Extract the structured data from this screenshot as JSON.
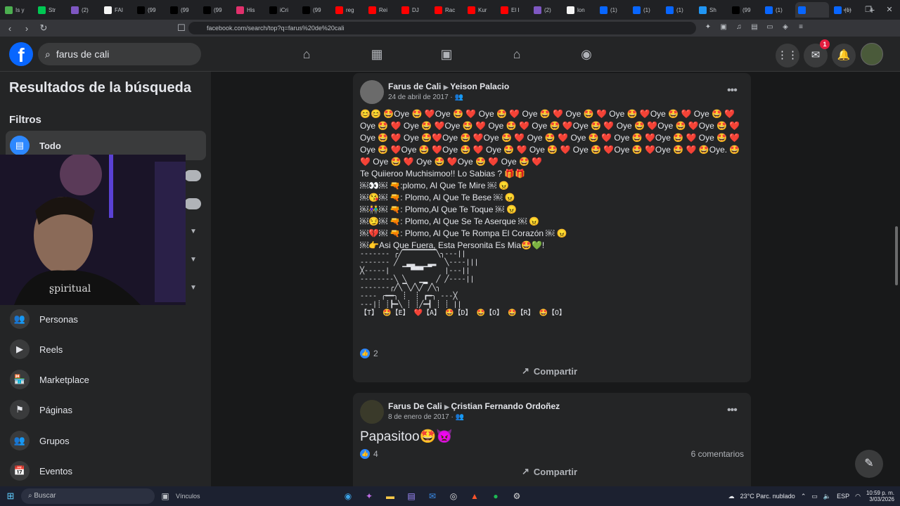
{
  "browser": {
    "tabs": [
      {
        "label": "Is y",
        "color": "#4caf50"
      },
      {
        "label": "Str",
        "color": "#00c853"
      },
      {
        "label": "(2)",
        "color": "#7e57c2"
      },
      {
        "label": "FAI",
        "color": "#f5f5f5"
      },
      {
        "label": "(99",
        "color": "#000000"
      },
      {
        "label": "(99",
        "color": "#000000"
      },
      {
        "label": "(99",
        "color": "#000000"
      },
      {
        "label": "His",
        "color": "#e1306c"
      },
      {
        "label": "iCri",
        "color": "#000000"
      },
      {
        "label": "(99",
        "color": "#000000"
      },
      {
        "label": "reg",
        "color": "#ff0000"
      },
      {
        "label": "Rei",
        "color": "#ff0000"
      },
      {
        "label": "DJ",
        "color": "#ff0000"
      },
      {
        "label": "Rac",
        "color": "#ff0000"
      },
      {
        "label": "Kur",
        "color": "#ff0000"
      },
      {
        "label": "El I",
        "color": "#ff0000"
      },
      {
        "label": "(2)",
        "color": "#7e57c2"
      },
      {
        "label": "lon",
        "color": "#f5f5f5"
      },
      {
        "label": "(1)",
        "color": "#0866ff"
      },
      {
        "label": "(1)",
        "color": "#0866ff"
      },
      {
        "label": "(1)",
        "color": "#0866ff"
      },
      {
        "label": "Sh",
        "color": "#2196f3"
      },
      {
        "label": "(99",
        "color": "#000000"
      },
      {
        "label": "(1)",
        "color": "#0866ff"
      },
      {
        "label": "",
        "color": "#0866ff"
      },
      {
        "label": "(1)",
        "color": "#0866ff"
      }
    ],
    "url": "facebook.com/search/top?q=farus%20de%20cali"
  },
  "fb": {
    "logo": "f",
    "search_value": "farus de cali",
    "notif_count": "1"
  },
  "sidebar": {
    "title": "Resultados de la búsqueda",
    "filters": "Filtros",
    "todo": "Todo",
    "items": [
      {
        "label": "Personas",
        "icon": "people-icon",
        "glyph": "👥"
      },
      {
        "label": "Reels",
        "icon": "reels-icon",
        "glyph": "▶"
      },
      {
        "label": "Marketplace",
        "icon": "marketplace-icon",
        "glyph": "🏪"
      },
      {
        "label": "Páginas",
        "icon": "flag-icon",
        "glyph": "⚑"
      },
      {
        "label": "Grupos",
        "icon": "groups-icon",
        "glyph": "👥"
      },
      {
        "label": "Eventos",
        "icon": "calendar-icon",
        "glyph": "📅"
      }
    ]
  },
  "post1": {
    "author": "Farus de Cali",
    "target": "Yeison Palacio",
    "date": "24 de abril de 2017 ·",
    "lines": [
      "😊😊 🤩Oye 🤩 ❤️Oye 🤩 ❤️ Oye 🤩 ❤️ Oye 🤩 ❤️ Oye 🤩 ❤️ Oye 🤩 ❤️Oye 🤩 ❤️ Oye 🤩 ❤️",
      "Oye 🤩 ❤️ Oye 🤩 ❤️Oye 🤩 ❤️ Oye 🤩 ❤️ Oye 🤩 ❤️Oye 🤩 ❤️ Oye 🤩 ❤️Oye 🤩 ❤️Oye 🤩 ❤️",
      "Oye 🤩 ❤️ Oye 🤩❤️Oye 🤩 ❤️Oye 🤩 ❤️ Oye 🤩 ❤️ Oye 🤩 ❤️ Oye 🤩 ❤️Oye 🤩 ❤️ Oye 🤩 ❤️",
      "Oye 🤩 ❤️Oye 🤩 ❤️Oye 🤩 ❤️ Oye 🤩 ❤️ Oye 🤩 ❤️ Oye 🤩 ❤️Oye 🤩 ❤️Oye 🤩 ❤️ 🤩Oye. 🤩",
      "❤️ Oye 🤩 ❤️ Oye 🤩 ❤️Oye 🤩 ❤️ Oye 🤩 ❤️",
      "Te Quiieroo Muchisimoo!! Lo Sabias ? 🎁🎁",
      "￼👀￼ 🔫:plomo, Al Que Te Mire ￼ 😠",
      "￼😘￼ 🔫: Plomo, Al Que Te Bese ￼ 😠",
      "￼👫￼ 🔫: Plomo,Al Que Te Toque ￼ 😠",
      "￼😏￼ 🔫: Plomo, Al Que Se Te Aserque ￼ 😠",
      "￼💔￼ 🔫: Plomo, Al Que Te Rompa El Corazón ￼ 😠",
      "￼👉Asi Que Fuera, Esta Personita Es Mia🤩💚!"
    ],
    "ascii": "------- ╭╱▔▔▔▔▔▔▔▔╲╮---||\n------- ╱  ▂▂   ▂▂  ╲----|||\n╳-----|   ▔▔▀▀▀▔▔   |---||\n--------╲ ╲   ▁▁  ╱ ╱----||\n-------╭╱╲▔╲╱╲╱▔╱╲╮\n---- ╭━━╮ ┊  ┊ ┏━╮ ---╳\n---|┊ ┊┣━╲ ┊ ┊╱━┫ ┊ ┊ ||\n【T】 🤩【E】 ❤️【A】 🤩【D】 🤩【O】 🤩【R】 🤩【O】",
    "likes": "2",
    "share": "Compartir"
  },
  "post2": {
    "author": "Farus De Cali",
    "target": "Çristian Fernando Ordoñez",
    "date": "8 de enero de 2017 ·",
    "text": "Papasitoo🤩👿",
    "likes": "4",
    "comments": "6 comentarios",
    "share": "Compartir"
  },
  "taskbar": {
    "search": "Buscar",
    "vinculos": "Vínculos",
    "weather": "23°C  Parc. nublado",
    "lang": "ESP",
    "time": "10:59 p. m.",
    "date": "3/03/2026"
  }
}
